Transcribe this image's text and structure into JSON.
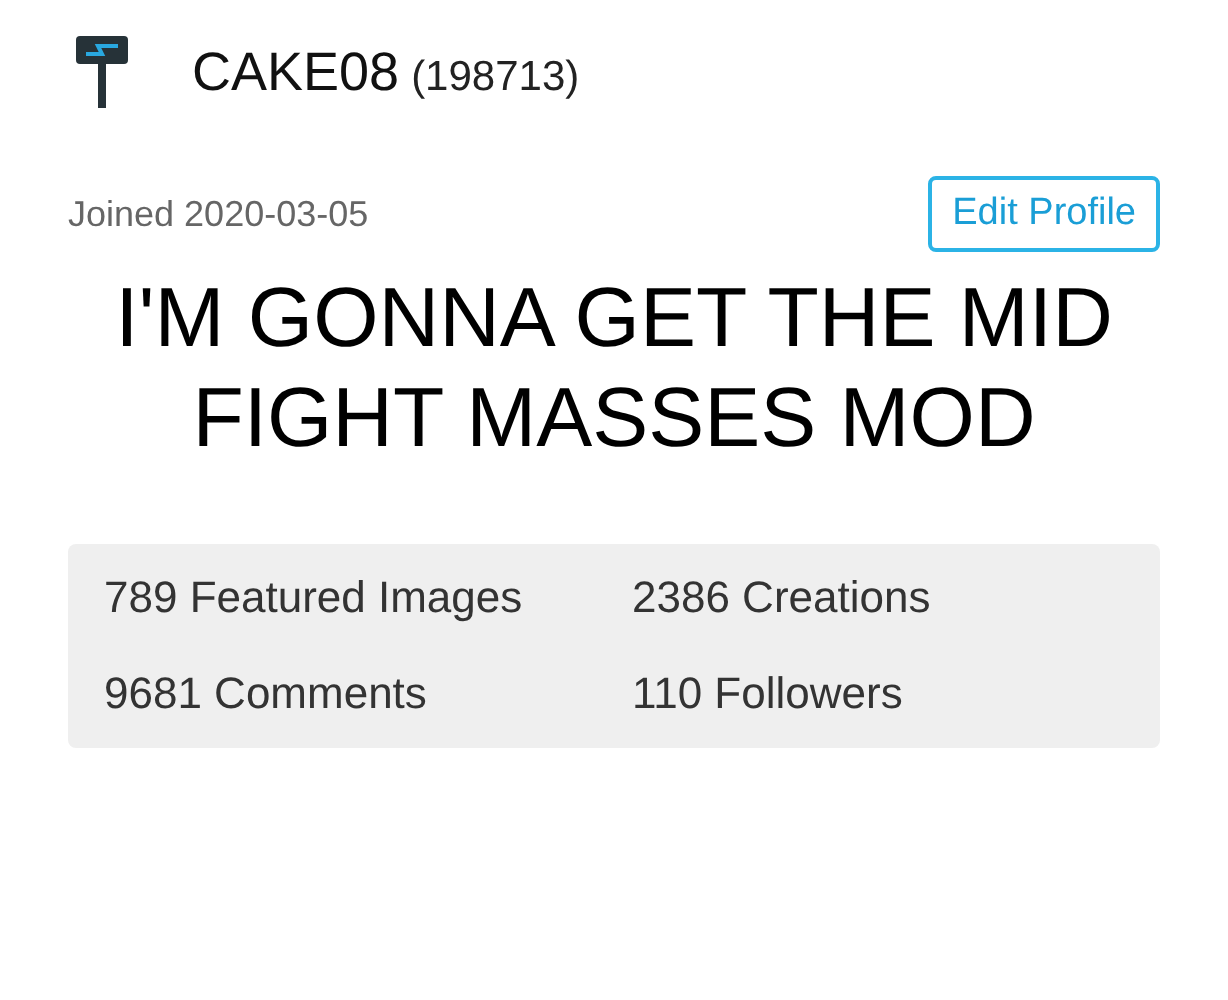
{
  "user": {
    "name": "CAKE08",
    "points": "(198713)",
    "joined": "Joined 2020-03-05"
  },
  "edit_button": "Edit Profile",
  "bio": "I'M GONNA GET THE MID FIGHT MASSES MOD",
  "stats": [
    {
      "text": "789 Featured Images"
    },
    {
      "text": "2386 Creations"
    },
    {
      "text": "9681 Comments"
    },
    {
      "text": "110 Followers"
    }
  ]
}
